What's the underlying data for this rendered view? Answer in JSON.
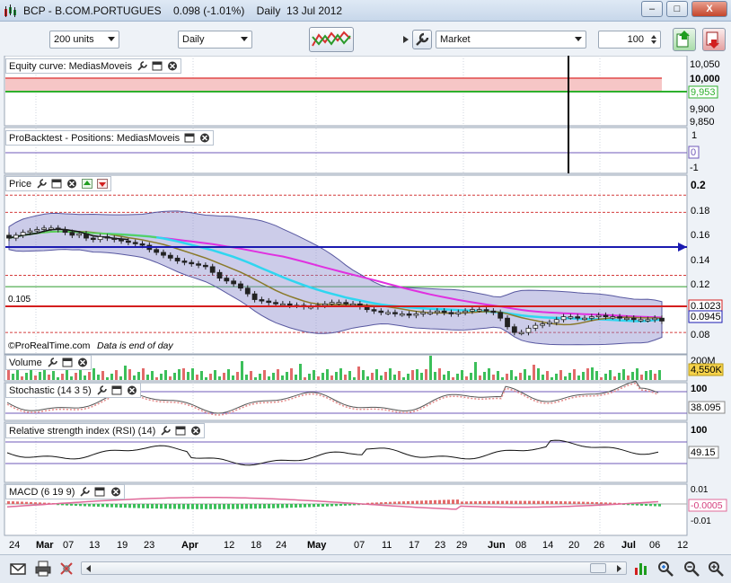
{
  "window": {
    "title": "BCP - B.COM.PORTUGUES",
    "price": "0.098 (-1.01%)",
    "period": "Daily",
    "date": "13 Jul 2012",
    "buttons": {
      "minimize": "–",
      "maximize": "□",
      "close": "X"
    }
  },
  "toolbar": {
    "units_select": "200 units",
    "timeframe_select": "Daily",
    "order_type_select": "Market",
    "quantity": "100"
  },
  "panels": {
    "equity": {
      "label": "Equity curve: MediasMoveis",
      "scale": [
        "10,050",
        "10,000",
        "9,900",
        "9,850"
      ],
      "value_tag": "9,953"
    },
    "backtest": {
      "label": "ProBacktest - Positions: MediasMoveis",
      "scale": [
        "1",
        "-1"
      ],
      "value_tag": "0"
    },
    "price": {
      "label": "Price",
      "scale": [
        "0.2",
        "0.18",
        "0.16",
        "0.14",
        "0.12",
        "0.08"
      ],
      "tag_1": "0.1023",
      "tag_2": "0.0945",
      "level_label": "0.105",
      "footer": "©ProRealTime.com",
      "footer_note": "Data is end of day"
    },
    "volume": {
      "label": "Volume",
      "scale": "200M",
      "value_tag": "4,550K"
    },
    "stochastic": {
      "label": "Stochastic (14 3 5)",
      "scale": "100",
      "value_tag": "38.095"
    },
    "rsi": {
      "label": "Relative strength index (RSI) (14)",
      "scale": "100",
      "value_tag": "49.15"
    },
    "macd": {
      "label": "MACD (6 19 9)",
      "scale": [
        "0.01",
        "-0.01"
      ],
      "value_tag": "-0.0005"
    }
  },
  "xaxis": {
    "labels": [
      "24",
      "Mar",
      "07",
      "13",
      "19",
      "23",
      "Apr",
      "12",
      "18",
      "24",
      "May",
      "07",
      "11",
      "17",
      "23",
      "29",
      "Jun",
      "08",
      "14",
      "20",
      "26",
      "Jul",
      "06",
      "12"
    ],
    "bold": [
      "Mar",
      "Apr",
      "May",
      "Jun",
      "Jul"
    ]
  },
  "colors": {
    "up": "#22b14c",
    "down": "#e25555",
    "ma_fast": "#111111",
    "ma_cyan": "#2fd6f0",
    "ma_magenta": "#e030e0",
    "ma_olive": "#8a7a2a",
    "bands": "#7070b8",
    "support": "#1a1ab0"
  },
  "chart_data": {
    "type": "candlestick",
    "symbol": "BCP - B.COM.PORTUGUES",
    "close": [
      0.156,
      0.158,
      0.16,
      0.161,
      0.162,
      0.163,
      0.163,
      0.162,
      0.16,
      0.158,
      0.159,
      0.156,
      0.155,
      0.157,
      0.156,
      0.155,
      0.154,
      0.153,
      0.152,
      0.151,
      0.148,
      0.146,
      0.144,
      0.142,
      0.14,
      0.139,
      0.138,
      0.137,
      0.136,
      0.132,
      0.128,
      0.126,
      0.124,
      0.121,
      0.117,
      0.113,
      0.112,
      0.111,
      0.11,
      0.11,
      0.109,
      0.109,
      0.108,
      0.108,
      0.109,
      0.11,
      0.111,
      0.111,
      0.11,
      0.11,
      0.108,
      0.106,
      0.105,
      0.104,
      0.104,
      0.103,
      0.103,
      0.102,
      0.103,
      0.104,
      0.104,
      0.105,
      0.104,
      0.103,
      0.104,
      0.105,
      0.106,
      0.106,
      0.105,
      0.104,
      0.1,
      0.094,
      0.09,
      0.09,
      0.093,
      0.095,
      0.096,
      0.097,
      0.099,
      0.101,
      0.101,
      0.1,
      0.1,
      0.101,
      0.102,
      0.101,
      0.101,
      0.1,
      0.1,
      0.099,
      0.099,
      0.099,
      0.1,
      0.098
    ],
    "yrange": [
      0.075,
      0.2
    ],
    "levels": [
      0.105,
      0.148,
      0.186,
      0.174,
      0.13,
      0.122,
      0.09
    ]
  }
}
